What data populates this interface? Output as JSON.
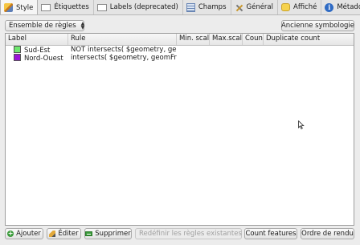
{
  "tabs": [
    {
      "label": "Style",
      "icon": "paint-brush-icon",
      "active": true
    },
    {
      "label": "Étiquettes",
      "icon": "label-icon",
      "active": false
    },
    {
      "label": "Labels (deprecated)",
      "icon": "label-icon",
      "active": false
    },
    {
      "label": "Champs",
      "icon": "table-icon",
      "active": false
    },
    {
      "label": "Général",
      "icon": "tools-icon",
      "active": false
    },
    {
      "label": "Affiché",
      "icon": "speech-bubble-icon",
      "active": false
    },
    {
      "label": "Métadonnées",
      "icon": "info-icon",
      "active": false
    }
  ],
  "renderer_select": {
    "value": "Ensemble de règles"
  },
  "old_symbology_button": "Ancienne symbologie",
  "table": {
    "columns": [
      "Label",
      "Rule",
      "Min. scale",
      "Max.scale",
      "Count",
      "Duplicate count"
    ],
    "rows": [
      {
        "label": "Sud-Est",
        "rule": "NOT intersects( $geometry, geo...",
        "min": "",
        "max": "",
        "count": "",
        "dup": "",
        "color": "#6ee86e"
      },
      {
        "label": "Nord-Ouest",
        "rule": "intersects( $geometry, geomFro...",
        "min": "",
        "max": "",
        "count": "",
        "dup": "",
        "color": "#9b14d8"
      }
    ]
  },
  "footer": {
    "add": "Ajouter",
    "edit": "Éditer",
    "remove": "Supprimer",
    "refine": "Redéfinir les règles existantes",
    "count_features": "Count features",
    "render_order": "Ordre de rendu"
  },
  "colors": {
    "accent_active_tab": "#f5f5f5"
  }
}
